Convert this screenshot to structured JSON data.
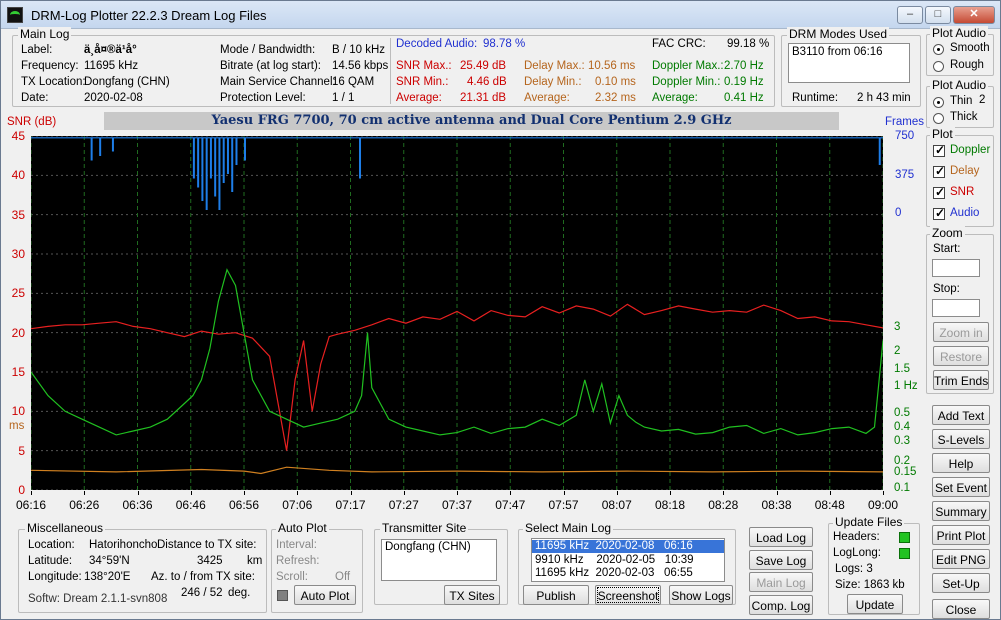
{
  "window": {
    "title": "DRM-Log Plotter 22.2.3   Dream Log Files"
  },
  "main_log": {
    "legend": "Main Log",
    "label_k": "Label:",
    "label_v": "ä¸­å¤®ä¹å°",
    "freq_k": "Frequency:",
    "freq_v": "11695   kHz",
    "tx_k": "TX Location:",
    "tx_v": "Dongfang (CHN)",
    "date_k": "Date:",
    "date_v": "2020-02-08",
    "mode_k": "Mode / Bandwidth:",
    "mode_v": "B / 10 kHz",
    "bitrate_k": "Bitrate (at log start):",
    "bitrate_v": "14.56 kbps",
    "msc_k": "Main Service Channel:",
    "msc_v": "16  QAM",
    "prot_k": "Protection Level:",
    "prot_v": "1 / 1",
    "decoded_k": "Decoded Audio:",
    "decoded_v": "98.78 %",
    "fac_k": "FAC  CRC:",
    "fac_v": "99.18 %",
    "snrmax_k": "SNR Max.:",
    "snrmax_v": "25.49  dB",
    "snrmin_k": "SNR Min.:",
    "snrmin_v": "4.46  dB",
    "snravg_k": "Average:",
    "snravg_v": "21.31  dB",
    "dlmax_k": "Delay Max.:",
    "dlmax_v": "10.56   ms",
    "dlmin_k": "Delay Min.:",
    "dlmin_v": "0.10   ms",
    "dlavg_k": "Average:",
    "dlavg_v": "2.32   ms",
    "dpmax_k": "Doppler Max.:",
    "dpmax_v": "2.70 Hz",
    "dpmin_k": "Doppler Min.:",
    "dpmin_v": "0.19 Hz",
    "dpavg_k": "Average:",
    "dpavg_v": "0.41 Hz"
  },
  "drm_modes": {
    "legend": "DRM Modes Used",
    "value": "B3110 from 06:16",
    "runtime_k": "Runtime:",
    "runtime_v": "2 h 43 min"
  },
  "plot_audio": {
    "legend": "Plot Audio",
    "smooth": "Smooth",
    "rough": "Rough"
  },
  "plot_audio2": {
    "legend": "Plot Audio",
    "thin": "Thin",
    "thick": "Thick",
    "thickness": "2"
  },
  "plot": {
    "legend": "Plot",
    "doppler": "Doppler",
    "delay": "Delay",
    "snr": "SNR",
    "audio": "Audio"
  },
  "zoom": {
    "legend": "Zoom",
    "start": "Start:",
    "stop": "Stop:",
    "zoom_in": "Zoom in",
    "restore": "Restore",
    "trim": "Trim Ends"
  },
  "side_buttons": {
    "add_text": "Add Text",
    "s_levels": "S-Levels",
    "help": "Help",
    "set_event": "Set Event",
    "summary": "Summary",
    "print_plot": "Print Plot",
    "edit_png": "Edit PNG",
    "set_up": "Set-Up",
    "close": "Close"
  },
  "chart_header": {
    "banner": "Yaesu FRG 7700, 70 cm active antenna and Dual Core Pentium 2.9 GHz",
    "snr_label": "SNR (dB)",
    "frames_label": "Frames",
    "ms_label": "ms"
  },
  "chart_data": {
    "type": "line",
    "x_ticks": [
      "06:16",
      "06:26",
      "06:36",
      "06:46",
      "06:56",
      "07:06",
      "07:17",
      "07:27",
      "07:37",
      "07:47",
      "07:57",
      "08:07",
      "08:18",
      "08:28",
      "08:38",
      "08:48",
      "09:00"
    ],
    "y_left_ticks": [
      "0",
      "5",
      "10",
      "15",
      "20",
      "25",
      "30",
      "35",
      "40",
      "45"
    ],
    "y_right_hz_ticks": [
      "0.1",
      "0.15",
      "0.2",
      "0.3",
      "0.4",
      "0.5",
      "1 Hz",
      "1.5",
      "2",
      "3"
    ],
    "y_right_frames_ticks": [
      "0",
      "375",
      "750"
    ],
    "ylim_snr": [
      0,
      45
    ],
    "series": [
      {
        "name": "SNR",
        "color": "#e82020",
        "axis": "snr_db",
        "x": [
          0,
          2,
          4,
          6,
          8,
          10,
          12,
          14,
          16,
          18,
          20,
          22,
          24,
          26,
          28,
          29,
          30,
          31,
          32,
          33,
          34,
          35,
          36,
          38,
          40,
          42,
          44,
          46,
          48,
          50,
          52,
          54,
          56,
          58,
          60,
          62,
          64,
          66,
          68,
          70,
          72,
          74,
          76,
          78,
          80,
          82,
          84,
          86,
          88,
          90,
          92,
          94,
          96,
          98,
          100
        ],
        "y": [
          20.5,
          20.8,
          21,
          21,
          21.2,
          21.4,
          20.8,
          20.5,
          20,
          19.5,
          20.2,
          19.8,
          20,
          19.3,
          17,
          11,
          5,
          14,
          19,
          10,
          16,
          19.5,
          19.8,
          20.3,
          21,
          21.8,
          21.2,
          22,
          21.7,
          22.7,
          21.5,
          22.8,
          22.2,
          22,
          23.3,
          22.5,
          23.4,
          23,
          22.1,
          23.6,
          22.3,
          22.8,
          23.4,
          23,
          22.6,
          22.8,
          22.6,
          23.5,
          22.8,
          21.8,
          22,
          21.5,
          21.4,
          21,
          20.6
        ]
      },
      {
        "name": "Doppler",
        "color": "#20c020",
        "axis": "snr_db",
        "x": [
          0,
          2,
          4,
          6,
          8,
          10,
          12,
          14,
          16,
          18,
          19,
          20,
          21,
          22,
          23,
          24,
          25,
          26,
          28,
          30,
          32,
          34,
          36,
          38,
          38.8,
          39.5,
          40,
          42,
          44,
          46,
          48,
          50,
          52,
          54,
          56,
          58,
          60,
          62,
          64,
          65,
          66,
          67,
          68,
          69,
          70,
          71,
          72,
          74,
          76,
          78,
          80,
          82,
          84,
          86,
          88,
          90,
          92,
          94,
          96,
          98,
          99,
          100
        ],
        "y": [
          15,
          12,
          10,
          9,
          8,
          7,
          7.5,
          8,
          9,
          11,
          12,
          14,
          18,
          24,
          28,
          26,
          20,
          14,
          10,
          9,
          8,
          8.5,
          9,
          10,
          12,
          20,
          13,
          9,
          8,
          7.5,
          7,
          7.3,
          8,
          7.2,
          7.8,
          8,
          9,
          8.2,
          9.5,
          14,
          10,
          13.5,
          8.5,
          12,
          9.5,
          8.6,
          8,
          7.5,
          7.7,
          7.1,
          7.3,
          8,
          8.2,
          7.2,
          7.8,
          7,
          7.3,
          7.8,
          8,
          7.2,
          8,
          19
        ]
      },
      {
        "name": "Delay",
        "color": "#d08020",
        "axis": "snr_db",
        "x": [
          0,
          10,
          20,
          25,
          27,
          30,
          35,
          40,
          50,
          60,
          70,
          80,
          90,
          100
        ],
        "y": [
          2.5,
          2.3,
          2.6,
          2.4,
          2.1,
          2.9,
          2.5,
          2.3,
          2.4,
          2.3,
          2.4,
          2.3,
          2.4,
          2.3
        ]
      },
      {
        "name": "Audio",
        "color": "#1e7ee8",
        "axis": "frames",
        "x": [
          0,
          100
        ],
        "y": [
          750,
          750
        ]
      }
    ]
  },
  "misc": {
    "legend": "Miscellaneous",
    "location_k": "Location:",
    "location_v": "Hatorihoncho",
    "dist_k": "Distance to TX site:",
    "dist_v": "3425",
    "dist_unit": "km",
    "lat_k": "Latitude:",
    "lat_v": "34°59'N",
    "lon_k": "Longitude:",
    "lon_v": "138°20'E",
    "az_k": "Az. to / from TX site:",
    "az_v": "246 / 52",
    "az_unit": "deg.",
    "soft": "Softw: Dream 2.1.1-svn808"
  },
  "auto_plot": {
    "legend": "Auto Plot",
    "interval": "Interval:",
    "refresh": "Refresh:",
    "scroll": "Scroll:",
    "scroll_v": "Off",
    "button": "Auto Plot"
  },
  "tx_site": {
    "legend": "Transmitter Site",
    "value": "Dongfang (CHN)",
    "button": "TX Sites"
  },
  "select_log": {
    "legend": "Select Main Log",
    "items": [
      {
        "f": "11695 kHz",
        "d": "2020-02-08",
        "t": "06:16"
      },
      {
        "f": "9910 kHz",
        "d": "2020-02-05",
        "t": "10:39"
      },
      {
        "f": "11695 kHz",
        "d": "2020-02-03",
        "t": "06:55"
      }
    ],
    "publish": "Publish",
    "screenshot": "Screenshot",
    "show_logs": "Show Logs"
  },
  "log_buttons": {
    "load": "Load Log",
    "save": "Save Log",
    "main": "Main Log",
    "comp": "Comp. Log"
  },
  "update": {
    "legend": "Update Files",
    "headers": "Headers:",
    "loglong": "LogLong:",
    "logs": "Logs: 3",
    "size": "Size:  1863 kb",
    "button": "Update"
  }
}
